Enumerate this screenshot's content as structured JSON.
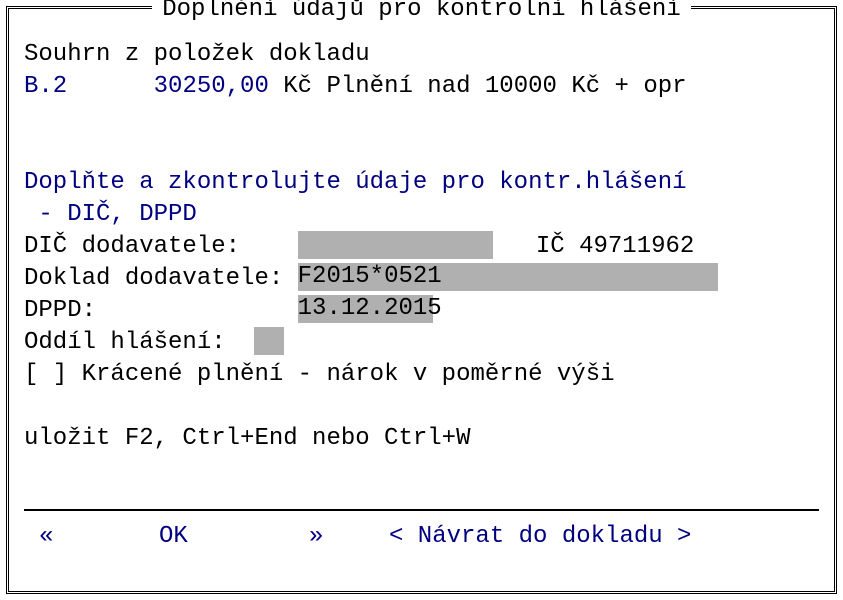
{
  "title": "Doplnění údajů pro kontrolní hlášení",
  "summary_header": "Souhrn z položek dokladu",
  "summary": {
    "section_code": "B.2",
    "amount": "30250,00",
    "currency_desc": "Kč Plnění nad 10000 Kč + opr"
  },
  "instruction_line1": "Doplňte a zkontrolujte údaje pro kontr.hlášení",
  "instruction_line2": " - DIČ, DPPD",
  "labels": {
    "dic_dodavatele": "DIČ dodavatele:",
    "ic": "IČ",
    "doklad_dodavatele": "Doklad dodavatele:",
    "dppd": "DPPD:",
    "oddil_hlaseni": "Oddíl hlášení:",
    "kracene_plneni": "Krácené plnění - nárok v poměrné výši"
  },
  "values": {
    "dic_dodavatele": "",
    "ic": "49711962",
    "doklad_dodavatele": "F2015*0521",
    "dppd": "13.12.2015",
    "oddil_hlaseni": "",
    "kracene_checked": " "
  },
  "hint": "uložit F2, Ctrl+End nebo Ctrl+W",
  "buttons": {
    "prev": "«",
    "ok": "OK",
    "next": "»",
    "return": "< Návrat do dokladu >"
  }
}
